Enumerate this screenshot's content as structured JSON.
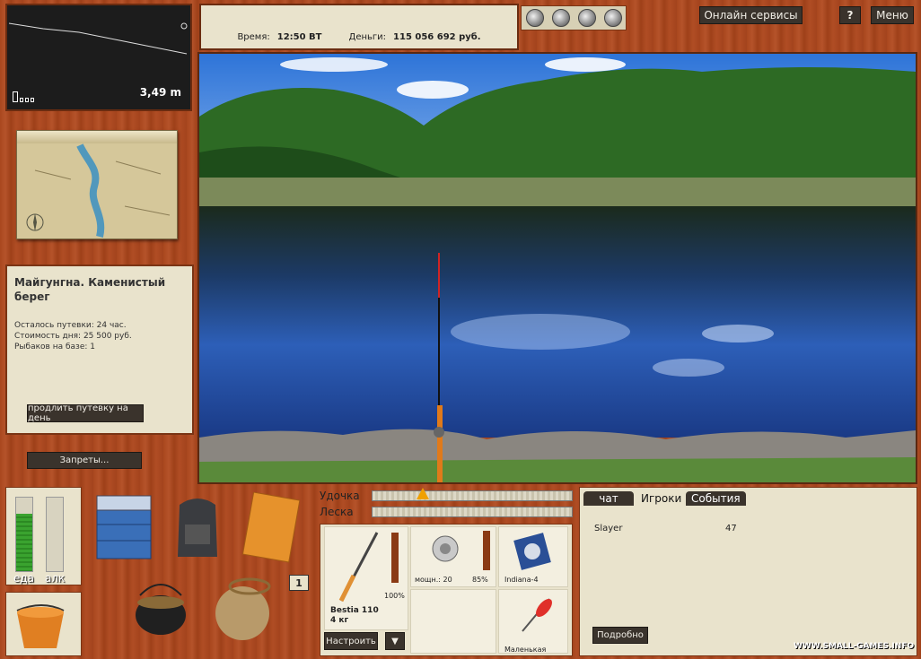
{
  "header": {
    "online_services": "Онлайн сервисы",
    "help": "?",
    "menu": "Меню"
  },
  "status": {
    "time_label": "Время:",
    "time_value": "12:50 ВТ",
    "money_label": "Деньги:",
    "money_value": "115 056 692 руб."
  },
  "reels": [
    "reel-icon",
    "reel-icon",
    "reel-icon",
    "reel-icon"
  ],
  "depth": {
    "value": "3,49 m"
  },
  "location": {
    "title": "Майгунгна. Каменистый берег",
    "remaining": "Осталось путевки: 24 час.",
    "day_cost": "Стоимость дня: 25 500 руб.",
    "fishers": "Рыбаков на базе: 1",
    "extend_button": "продлить путевку на день",
    "bans_button": "Запреты..."
  },
  "needs": {
    "food_label": "еда",
    "alcohol_label": "алк",
    "food_level": 0.78,
    "alcohol_level": 0.0,
    "count_badge": "1"
  },
  "tension": {
    "rod_label": "Удочка",
    "line_label": "Леска",
    "rod_level": 0.25,
    "line_level": 0.0
  },
  "tackle": {
    "rod_name": "Bestia 110",
    "rod_weight": "4 кг",
    "rod_condition": "100%",
    "reel_power": "мощн.: 20",
    "reel_condition": "85%",
    "line_name": "Indiana-4",
    "lure_name": "Маленькая",
    "adjust_button": "Настроить",
    "dropdown_button": "▼"
  },
  "chat": {
    "tabs": [
      "чат",
      "Игроки",
      "События"
    ],
    "active_tab": 1,
    "players": [
      {
        "name": "Slayer",
        "value": "47"
      }
    ],
    "details_button": "Подробно"
  },
  "watermark": "WWW.SMALL-GAMES.INFO"
}
